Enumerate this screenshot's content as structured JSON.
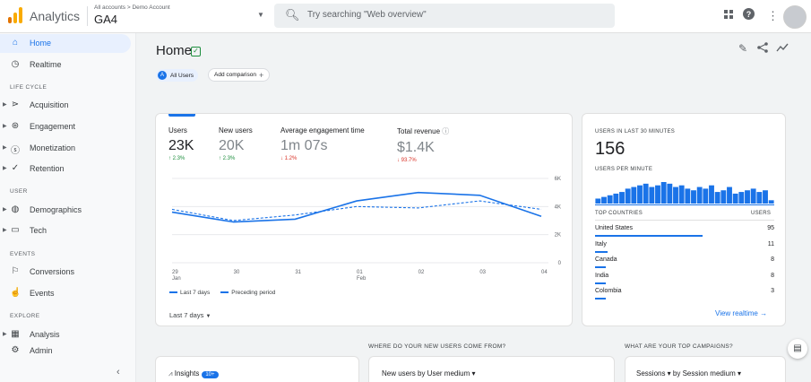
{
  "topbar": {
    "app_name": "Analytics",
    "account_path": "All accounts > Demo Account",
    "property": "GA4",
    "search_placeholder": "Try searching \"Web overview\""
  },
  "sidebar": {
    "home": "Home",
    "realtime": "Realtime",
    "lifecycle_header": "LIFE CYCLE",
    "acquisition": "Acquisition",
    "engagement": "Engagement",
    "monetization": "Monetization",
    "retention": "Retention",
    "user_header": "USER",
    "demographics": "Demographics",
    "tech": "Tech",
    "events_header": "EVENTS",
    "conversions": "Conversions",
    "events": "Events",
    "explore_header": "EXPLORE",
    "analysis": "Analysis",
    "admin": "Admin"
  },
  "header": {
    "title": "Home",
    "all_users": "All Users",
    "all_users_letter": "A",
    "add_comparison": "Add comparison"
  },
  "overview": {
    "metrics": [
      {
        "label": "Users",
        "value": "23K",
        "delta": "↑ 2.3%",
        "dir": "up"
      },
      {
        "label": "New users",
        "value": "20K",
        "delta": "↑ 2.3%",
        "dir": "up"
      },
      {
        "label": "Average engagement time",
        "value": "1m 07s",
        "delta": "↓ 1.2%",
        "dir": "down"
      },
      {
        "label": "Total revenue",
        "value": "$1.4K",
        "delta": "↓ 93.7%",
        "dir": "down"
      }
    ],
    "legend_current": "Last 7 days",
    "legend_previous": "Preceding period",
    "date_range": "Last 7 days"
  },
  "chart_data": {
    "type": "line",
    "x": [
      "29\nJan",
      "30",
      "31",
      "01\nFeb",
      "02",
      "03",
      "04"
    ],
    "yticks": [
      "0",
      "2K",
      "4K",
      "6K"
    ],
    "ylim": [
      0,
      6000
    ],
    "series": [
      {
        "name": "Last 7 days",
        "values": [
          3600,
          2900,
          3100,
          4400,
          5000,
          4800,
          3300
        ]
      },
      {
        "name": "Preceding period",
        "values": [
          3800,
          3000,
          3400,
          4000,
          3900,
          4400,
          3800
        ]
      }
    ],
    "colors": {
      "current": "#1a73e8",
      "previous": "#1a73e8"
    }
  },
  "realtime": {
    "users_label": "USERS IN LAST 30 MINUTES",
    "users_value": "156",
    "per_minute_label": "USERS PER MINUTE",
    "per_minute": [
      3,
      4,
      5,
      6,
      7,
      9,
      10,
      11,
      12,
      10,
      11,
      13,
      12,
      10,
      11,
      9,
      8,
      10,
      9,
      11,
      7,
      8,
      10,
      6,
      7,
      8,
      9,
      7,
      8,
      2
    ],
    "countries_header": "TOP COUNTRIES",
    "users_header": "USERS",
    "countries": [
      {
        "name": "United States",
        "users": "95",
        "share": 0.6
      },
      {
        "name": "Italy",
        "users": "11",
        "share": 0.07
      },
      {
        "name": "Canada",
        "users": "8",
        "share": 0.05
      },
      {
        "name": "India",
        "users": "8",
        "share": 0.05
      },
      {
        "name": "Colombia",
        "users": "3",
        "share": 0.02
      }
    ],
    "view_realtime": "View realtime →"
  },
  "sections": {
    "new_users_question": "WHERE DO YOUR NEW USERS COME FROM?",
    "campaigns_question": "WHAT ARE YOUR TOP CAMPAIGNS?",
    "insights": "Insights",
    "insights_badge": "10+",
    "new_users_by": "New users by User medium ▾",
    "sessions_by": "Sessions ▾  by Session medium ▾"
  },
  "colors": {
    "accent": "#1a73e8",
    "up": "#1e8e3e",
    "down": "#d93025"
  }
}
